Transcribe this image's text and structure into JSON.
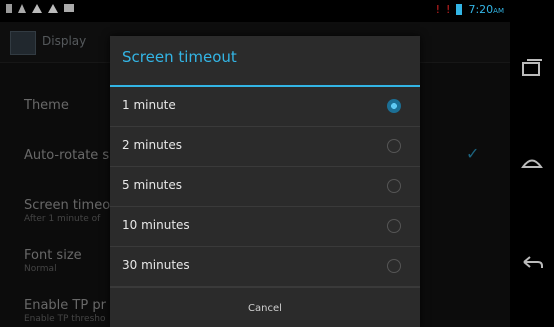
{
  "status_bar": {
    "time": "7:20",
    "ampm": "AM",
    "icons": [
      "notification-icon",
      "usb-icon",
      "warning-icon",
      "warning-icon",
      "download-icon",
      "battery-icon"
    ]
  },
  "action_bar": {
    "title": "Display"
  },
  "settings": {
    "theme": {
      "label": "Theme"
    },
    "auto_rotate": {
      "label": "Auto-rotate s"
    },
    "screen_timeout": {
      "label": "Screen timeou",
      "summary": "After 1 minute of"
    },
    "font_size": {
      "label": "Font size",
      "summary": "Normal"
    },
    "enable_tp": {
      "label": "Enable TP pr",
      "summary": "Enable TP thresho"
    }
  },
  "dialog": {
    "title": "Screen timeout",
    "options": [
      {
        "label": "1 minute",
        "selected": true
      },
      {
        "label": "2 minutes",
        "selected": false
      },
      {
        "label": "5 minutes",
        "selected": false
      },
      {
        "label": "10 minutes",
        "selected": false
      },
      {
        "label": "30 minutes",
        "selected": false
      }
    ],
    "cancel_label": "Cancel"
  },
  "colors": {
    "accent": "#33b5e5",
    "warning": "#cc2222",
    "dialog_bg": "#2b2b2b"
  },
  "nav": [
    "recent-apps-icon",
    "home-icon",
    "back-icon"
  ]
}
